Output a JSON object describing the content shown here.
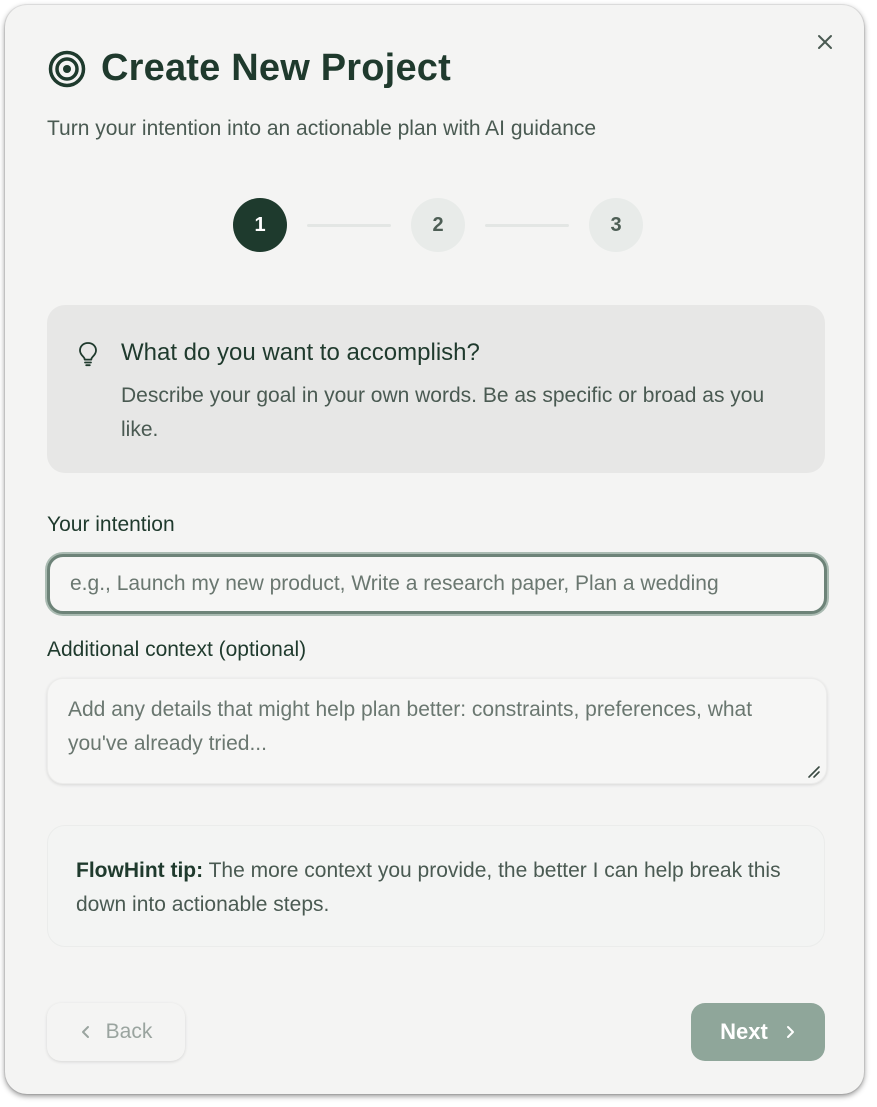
{
  "dialog": {
    "title": "Create New Project",
    "subtitle": "Turn your intention into an actionable plan with AI guidance"
  },
  "stepper": {
    "steps": [
      "1",
      "2",
      "3"
    ],
    "current": 1
  },
  "info_card": {
    "heading": "What do you want to accomplish?",
    "description": "Describe your goal in your own words. Be as specific or broad as you like."
  },
  "intention": {
    "label": "Your intention",
    "value": "",
    "placeholder": "e.g., Launch my new product, Write a research paper, Plan a wedding"
  },
  "context": {
    "label": "Additional context (optional)",
    "value": "",
    "placeholder": "Add any details that might help plan better: constraints, preferences, what you've already tried..."
  },
  "tip": {
    "prefix": "FlowHint tip:",
    "text": " The more context you provide, the better I can help break this down into actionable steps."
  },
  "footer": {
    "back_label": "Back",
    "next_label": "Next"
  },
  "icons": {
    "close": "close-icon",
    "title": "target-icon",
    "info": "lightbulb-icon",
    "back": "chevron-left-icon",
    "next": "chevron-right-icon"
  },
  "colors": {
    "primary": "#1e3a2d",
    "next_button": "#8fa69a",
    "background": "#f4f4f3"
  }
}
